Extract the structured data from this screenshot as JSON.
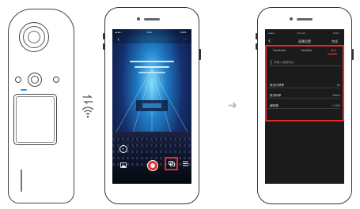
{
  "phone1": {
    "status_carrier": "●●●●○",
    "status_time": "9:41",
    "status_battery": "100%",
    "icons": [
      "gyro-icon",
      "gallery-icon",
      "live-record-icon",
      "live-settings-icon",
      "menu-icon"
    ]
  },
  "phone2": {
    "status_carrier": "●●●●○",
    "status_time": "9:41 AM",
    "status_battery": "100%",
    "nav_title": "直播设置",
    "nav_done": "完成",
    "tabs": [
      {
        "label": "Facebook"
      },
      {
        "label": "YouTube"
      },
      {
        "label": "其它"
      }
    ],
    "url_placeholder": "请输入直播地址...",
    "settings_rows": [
      {
        "label": "推流分辨率",
        "value": "4K"
      },
      {
        "label": "推流码率",
        "value": "4Mb/s"
      },
      {
        "label": "编码器",
        "value": "H.264"
      }
    ]
  },
  "colors": {
    "highlight": "#e8272b",
    "active_tab": "#ff4a3d",
    "live_button": "#e0322e",
    "camera_led": "#1a9bff"
  }
}
